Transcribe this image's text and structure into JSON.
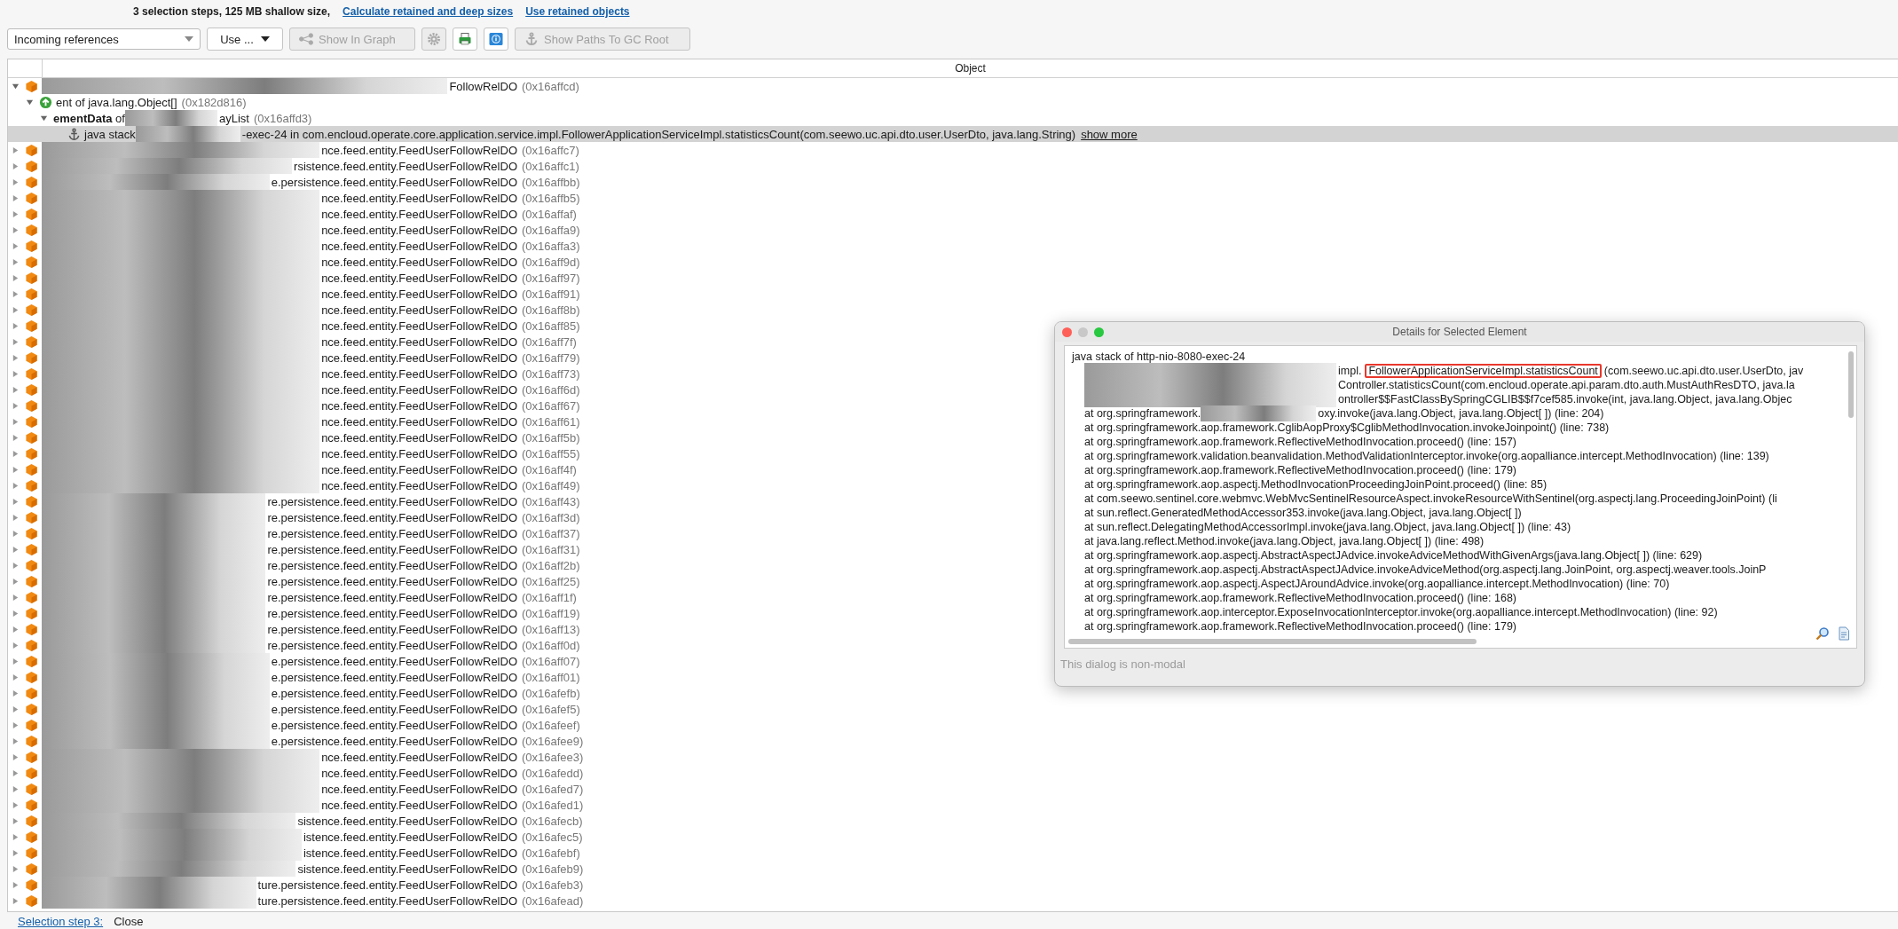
{
  "summary": {
    "text": "3 selection steps, 125 MB shallow size,",
    "links": [
      "Calculate retained and deep sizes",
      "Use retained objects"
    ]
  },
  "toolbar": {
    "reference_mode": "Incoming references",
    "use_menu": "Use ...",
    "buttons": [
      {
        "kind": "graph",
        "label": "Show In Graph",
        "disabled": true
      },
      {
        "kind": "settings",
        "disabled": true
      },
      {
        "kind": "export",
        "disabled": false
      },
      {
        "kind": "info",
        "disabled": false
      },
      {
        "kind": "gc-root",
        "label": "Show Paths To GC Root",
        "disabled": true
      }
    ]
  },
  "table": {
    "column": "Object",
    "rows": [
      {
        "kind": "object",
        "expanded": true,
        "selected": false,
        "name": "FollowRelDO",
        "address": "(0x16affcd)",
        "children": [
          {
            "kind": "array",
            "expanded": true,
            "selected": false,
            "name": "ent of java.lang.Object[]",
            "address": "(0x182d816)",
            "children": [
              {
                "kind": "field",
                "expanded": true,
                "selected": false,
                "field": "**ementData** of",
                "name": "ayList",
                "address": "(0x16affd3)",
                "children": [
                  {
                    "kind": "stack",
                    "selected": true,
                    "label": "java stack",
                    "name": "-exec-24 in com.encloud.operate.core.application.service.impl.FollowerApplicationServiceImpl.statisticsCount(com.seewo.uc.api.dto.user.UserDto, java.lang.String)",
                    "link": "show more"
                  }
                ]
              }
            ]
          }
        ]
      },
      {
        "kind": "object",
        "expanded": false,
        "selected": false,
        "name": "nce.feed.entity.FeedUserFollowRelDO",
        "address": "(0x16affc7)"
      },
      {
        "kind": "object",
        "expanded": false,
        "selected": false,
        "name": "rsistence.feed.entity.FeedUserFollowRelDO",
        "address": "(0x16affc1)"
      },
      {
        "kind": "object",
        "expanded": false,
        "selected": false,
        "name": "e.persistence.feed.entity.FeedUserFollowRelDO",
        "address": "(0x16affbb)"
      },
      {
        "kind": "object",
        "expanded": false,
        "selected": false,
        "name": "nce.feed.entity.FeedUserFollowRelDO",
        "address": "(0x16affb5)"
      },
      {
        "kind": "object",
        "expanded": false,
        "selected": false,
        "name": "nce.feed.entity.FeedUserFollowRelDO",
        "address": "(0x16affaf)"
      },
      {
        "kind": "object",
        "expanded": false,
        "selected": false,
        "name": "nce.feed.entity.FeedUserFollowRelDO",
        "address": "(0x16affa9)"
      },
      {
        "kind": "object",
        "expanded": false,
        "selected": false,
        "name": "nce.feed.entity.FeedUserFollowRelDO",
        "address": "(0x16affa3)"
      },
      {
        "kind": "object",
        "expanded": false,
        "selected": false,
        "name": "nce.feed.entity.FeedUserFollowRelDO",
        "address": "(0x16aff9d)"
      },
      {
        "kind": "object",
        "expanded": false,
        "selected": false,
        "name": "nce.feed.entity.FeedUserFollowRelDO",
        "address": "(0x16aff97)"
      },
      {
        "kind": "object",
        "expanded": false,
        "selected": false,
        "name": "nce.feed.entity.FeedUserFollowRelDO",
        "address": "(0x16aff91)"
      },
      {
        "kind": "object",
        "expanded": false,
        "selected": false,
        "name": "nce.feed.entity.FeedUserFollowRelDO",
        "address": "(0x16aff8b)"
      },
      {
        "kind": "object",
        "expanded": false,
        "selected": false,
        "name": "nce.feed.entity.FeedUserFollowRelDO",
        "address": "(0x16aff85)"
      },
      {
        "kind": "object",
        "expanded": false,
        "selected": false,
        "name": "nce.feed.entity.FeedUserFollowRelDO",
        "address": "(0x16aff7f)"
      },
      {
        "kind": "object",
        "expanded": false,
        "selected": false,
        "name": "nce.feed.entity.FeedUserFollowRelDO",
        "address": "(0x16aff79)"
      },
      {
        "kind": "object",
        "expanded": false,
        "selected": false,
        "name": "nce.feed.entity.FeedUserFollowRelDO",
        "address": "(0x16aff73)"
      },
      {
        "kind": "object",
        "expanded": false,
        "selected": false,
        "name": "nce.feed.entity.FeedUserFollowRelDO",
        "address": "(0x16aff6d)"
      },
      {
        "kind": "object",
        "expanded": false,
        "selected": false,
        "name": "nce.feed.entity.FeedUserFollowRelDO",
        "address": "(0x16aff67)"
      },
      {
        "kind": "object",
        "expanded": false,
        "selected": false,
        "name": "nce.feed.entity.FeedUserFollowRelDO",
        "address": "(0x16aff61)"
      },
      {
        "kind": "object",
        "expanded": false,
        "selected": false,
        "name": "nce.feed.entity.FeedUserFollowRelDO",
        "address": "(0x16aff5b)"
      },
      {
        "kind": "object",
        "expanded": false,
        "selected": false,
        "name": "nce.feed.entity.FeedUserFollowRelDO",
        "address": "(0x16aff55)"
      },
      {
        "kind": "object",
        "expanded": false,
        "selected": false,
        "name": "nce.feed.entity.FeedUserFollowRelDO",
        "address": "(0x16aff4f)"
      },
      {
        "kind": "object",
        "expanded": false,
        "selected": false,
        "name": "nce.feed.entity.FeedUserFollowRelDO",
        "address": "(0x16aff49)"
      },
      {
        "kind": "object",
        "expanded": false,
        "selected": false,
        "name": "re.persistence.feed.entity.FeedUserFollowRelDO",
        "address": "(0x16aff43)"
      },
      {
        "kind": "object",
        "expanded": false,
        "selected": false,
        "name": "re.persistence.feed.entity.FeedUserFollowRelDO",
        "address": "(0x16aff3d)"
      },
      {
        "kind": "object",
        "expanded": false,
        "selected": false,
        "name": "re.persistence.feed.entity.FeedUserFollowRelDO",
        "address": "(0x16aff37)"
      },
      {
        "kind": "object",
        "expanded": false,
        "selected": false,
        "name": "re.persistence.feed.entity.FeedUserFollowRelDO",
        "address": "(0x16aff31)"
      },
      {
        "kind": "object",
        "expanded": false,
        "selected": false,
        "name": "re.persistence.feed.entity.FeedUserFollowRelDO",
        "address": "(0x16aff2b)"
      },
      {
        "kind": "object",
        "expanded": false,
        "selected": false,
        "name": "re.persistence.feed.entity.FeedUserFollowRelDO",
        "address": "(0x16aff25)"
      },
      {
        "kind": "object",
        "expanded": false,
        "selected": false,
        "name": "re.persistence.feed.entity.FeedUserFollowRelDO",
        "address": "(0x16aff1f)"
      },
      {
        "kind": "object",
        "expanded": false,
        "selected": false,
        "name": "re.persistence.feed.entity.FeedUserFollowRelDO",
        "address": "(0x16aff19)"
      },
      {
        "kind": "object",
        "expanded": false,
        "selected": false,
        "name": "re.persistence.feed.entity.FeedUserFollowRelDO",
        "address": "(0x16aff13)"
      },
      {
        "kind": "object",
        "expanded": false,
        "selected": false,
        "name": "re.persistence.feed.entity.FeedUserFollowRelDO",
        "address": "(0x16aff0d)"
      },
      {
        "kind": "object",
        "expanded": false,
        "selected": false,
        "name": "e.persistence.feed.entity.FeedUserFollowRelDO",
        "address": "(0x16aff07)"
      },
      {
        "kind": "object",
        "expanded": false,
        "selected": false,
        "name": "e.persistence.feed.entity.FeedUserFollowRelDO",
        "address": "(0x16aff01)"
      },
      {
        "kind": "object",
        "expanded": false,
        "selected": false,
        "name": "e.persistence.feed.entity.FeedUserFollowRelDO",
        "address": "(0x16afefb)"
      },
      {
        "kind": "object",
        "expanded": false,
        "selected": false,
        "name": "e.persistence.feed.entity.FeedUserFollowRelDO",
        "address": "(0x16afef5)"
      },
      {
        "kind": "object",
        "expanded": false,
        "selected": false,
        "name": "e.persistence.feed.entity.FeedUserFollowRelDO",
        "address": "(0x16afeef)"
      },
      {
        "kind": "object",
        "expanded": false,
        "selected": false,
        "name": "e.persistence.feed.entity.FeedUserFollowRelDO",
        "address": "(0x16afee9)"
      },
      {
        "kind": "object",
        "expanded": false,
        "selected": false,
        "name": "nce.feed.entity.FeedUserFollowRelDO",
        "address": "(0x16afee3)"
      },
      {
        "kind": "object",
        "expanded": false,
        "selected": false,
        "name": "nce.feed.entity.FeedUserFollowRelDO",
        "address": "(0x16afedd)"
      },
      {
        "kind": "object",
        "expanded": false,
        "selected": false,
        "name": "nce.feed.entity.FeedUserFollowRelDO",
        "address": "(0x16afed7)"
      },
      {
        "kind": "object",
        "expanded": false,
        "selected": false,
        "name": "nce.feed.entity.FeedUserFollowRelDO",
        "address": "(0x16afed1)"
      },
      {
        "kind": "object",
        "expanded": false,
        "selected": false,
        "name": "sistence.feed.entity.FeedUserFollowRelDO",
        "address": "(0x16afecb)"
      },
      {
        "kind": "object",
        "expanded": false,
        "selected": false,
        "name": "istence.feed.entity.FeedUserFollowRelDO",
        "address": "(0x16afec5)"
      },
      {
        "kind": "object",
        "expanded": false,
        "selected": false,
        "name": "istence.feed.entity.FeedUserFollowRelDO",
        "address": "(0x16afebf)"
      },
      {
        "kind": "object",
        "expanded": false,
        "selected": false,
        "name": "sistence.feed.entity.FeedUserFollowRelDO",
        "address": "(0x16afeb9)"
      },
      {
        "kind": "object",
        "expanded": false,
        "selected": false,
        "name": "ture.persistence.feed.entity.FeedUserFollowRelDO",
        "address": "(0x16afeb3)"
      },
      {
        "kind": "object",
        "expanded": false,
        "selected": false,
        "name": "ture.persistence.feed.entity.FeedUserFollowRelDO",
        "address": "(0x16afead)"
      }
    ]
  },
  "details_dialog": {
    "title": "Details for Selected Element",
    "lines": [
      {
        "text": "java stack of http-nio-8080-exec-24",
        "kind": "header"
      },
      {
        "kind": "redacted",
        "text": "impl.",
        "highlight": "FollowerApplicationServiceImpl.statisticsCount",
        "rest": "(com.seewo.uc.api.dto.user.UserDto, jav"
      },
      {
        "kind": "redacted",
        "text": "Controller.statisticsCount(com.encloud.operate.api.param.dto.auth.MustAuthResDTO, java.la"
      },
      {
        "kind": "redacted",
        "text": "ontroller$$FastClassBySpringCGLIB$$f7cef585.invoke(int, java.lang.Object, java.lang.Objec"
      },
      {
        "kind": "partial",
        "before": "at org.springframework.",
        "text": "oxy.invoke(java.lang.Object, java.lang.Object[ ]) (line: 204)"
      },
      {
        "kind": "frame",
        "text": "at org.springframework.aop.framework.CglibAopProxy$CglibMethodInvocation.invokeJoinpoint() (line: 738)"
      },
      {
        "kind": "frame",
        "text": "at org.springframework.aop.framework.ReflectiveMethodInvocation.proceed() (line: 157)"
      },
      {
        "kind": "frame",
        "text": "at org.springframework.validation.beanvalidation.MethodValidationInterceptor.invoke(org.aopalliance.intercept.MethodInvocation) (line: 139)"
      },
      {
        "kind": "frame",
        "text": "at org.springframework.aop.framework.ReflectiveMethodInvocation.proceed() (line: 179)"
      },
      {
        "kind": "frame",
        "text": "at org.springframework.aop.aspectj.MethodInvocationProceedingJoinPoint.proceed() (line: 85)"
      },
      {
        "kind": "frame",
        "text": "at com.seewo.sentinel.core.webmvc.WebMvcSentinelResourceAspect.invokeResourceWithSentinel(org.aspectj.lang.ProceedingJoinPoint) (li"
      },
      {
        "kind": "frame",
        "text": "at sun.reflect.GeneratedMethodAccessor353.invoke(java.lang.Object, java.lang.Object[ ])"
      },
      {
        "kind": "frame",
        "text": "at sun.reflect.DelegatingMethodAccessorImpl.invoke(java.lang.Object, java.lang.Object[ ]) (line: 43)"
      },
      {
        "kind": "frame",
        "text": "at java.lang.reflect.Method.invoke(java.lang.Object, java.lang.Object[ ]) (line: 498)"
      },
      {
        "kind": "frame",
        "text": "at org.springframework.aop.aspectj.AbstractAspectJAdvice.invokeAdviceMethodWithGivenArgs(java.lang.Object[ ]) (line: 629)"
      },
      {
        "kind": "frame",
        "text": "at org.springframework.aop.aspectj.AbstractAspectJAdvice.invokeAdviceMethod(org.aspectj.lang.JoinPoint, org.aspectj.weaver.tools.JoinP"
      },
      {
        "kind": "frame",
        "text": "at org.springframework.aop.aspectj.AspectJAroundAdvice.invoke(org.aopalliance.intercept.MethodInvocation) (line: 70)"
      },
      {
        "kind": "frame",
        "text": "at org.springframework.aop.framework.ReflectiveMethodInvocation.proceed() (line: 168)"
      },
      {
        "kind": "frame",
        "text": "at org.springframework.aop.interceptor.ExposeInvocationInterceptor.invoke(org.aopalliance.intercept.MethodInvocation) (line: 92)"
      },
      {
        "kind": "frame",
        "text": "at org.springframework.aop.framework.ReflectiveMethodInvocation.proceed() (line: 179)"
      }
    ],
    "footer": "This dialog is non-modal"
  },
  "bottom_bar": {
    "step_link": "Selection step 3:",
    "button": "Close"
  }
}
